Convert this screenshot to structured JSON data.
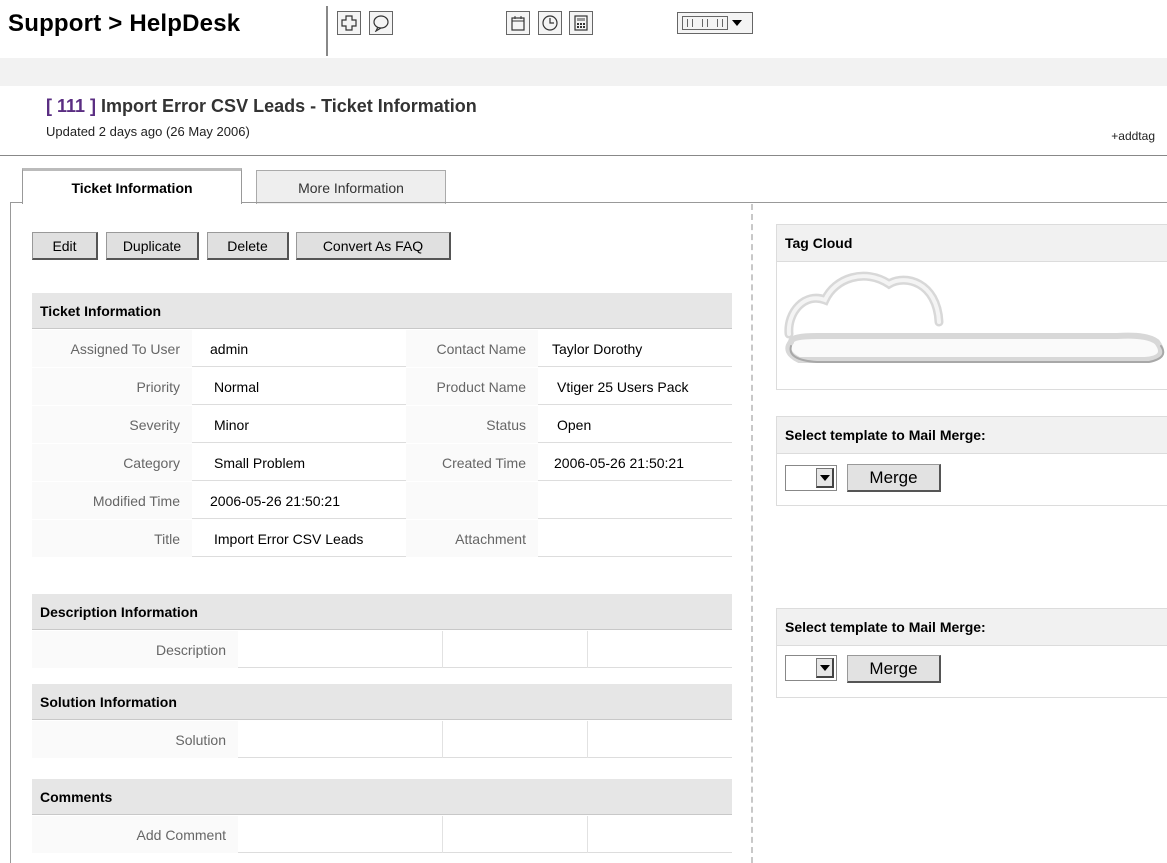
{
  "header": {
    "module_title": "Support > HelpDesk",
    "toolbar_icons": [
      "add-icon",
      "search-icon",
      "calendar-icon",
      "clock-icon",
      "calculator-icon",
      "columns-menu-icon"
    ]
  },
  "record": {
    "id_label": "[ 111 ]",
    "title": " Import Error CSV Leads - Ticket Information",
    "updated": "Updated 2 days ago (26 May 2006)",
    "addtag": "+addtag"
  },
  "tabs": {
    "active": "Ticket Information",
    "inactive": "More Information"
  },
  "actions": {
    "edit": "Edit",
    "duplicate": "Duplicate",
    "delete": "Delete",
    "convert": "Convert As FAQ"
  },
  "ticket_info": {
    "heading": "Ticket Information",
    "rows": [
      {
        "l1": "Assigned To User",
        "v1": "admin",
        "l2": "Contact Name",
        "v2": "Taylor Dorothy"
      },
      {
        "l1": "Priority",
        "v1": "Normal",
        "l2": "Product Name",
        "v2": "Vtiger 25 Users Pack"
      },
      {
        "l1": "Severity",
        "v1": "Minor",
        "l2": "Status",
        "v2": "Open"
      },
      {
        "l1": "Category",
        "v1": "Small Problem",
        "l2": "Created Time",
        "v2": "2006-05-26 21:50:21"
      },
      {
        "l1": "Modified Time",
        "v1": "2006-05-26 21:50:21",
        "l2": "",
        "v2": ""
      },
      {
        "l1": "Title",
        "v1": "Import Error CSV Leads",
        "l2": "Attachment",
        "v2": ""
      }
    ]
  },
  "description": {
    "heading": "Description Information",
    "label": "Description"
  },
  "solution": {
    "heading": "Solution Information",
    "label": "Solution"
  },
  "comments": {
    "heading": "Comments",
    "label": "Add Comment"
  },
  "right_panel": {
    "tag_cloud_heading": "Tag Cloud",
    "mail_merge_heading_1": "Select template to Mail Merge:",
    "merge_label_1": "Merge",
    "mail_merge_heading_2": "Select template to Mail Merge:",
    "merge_label_2": "Merge"
  }
}
